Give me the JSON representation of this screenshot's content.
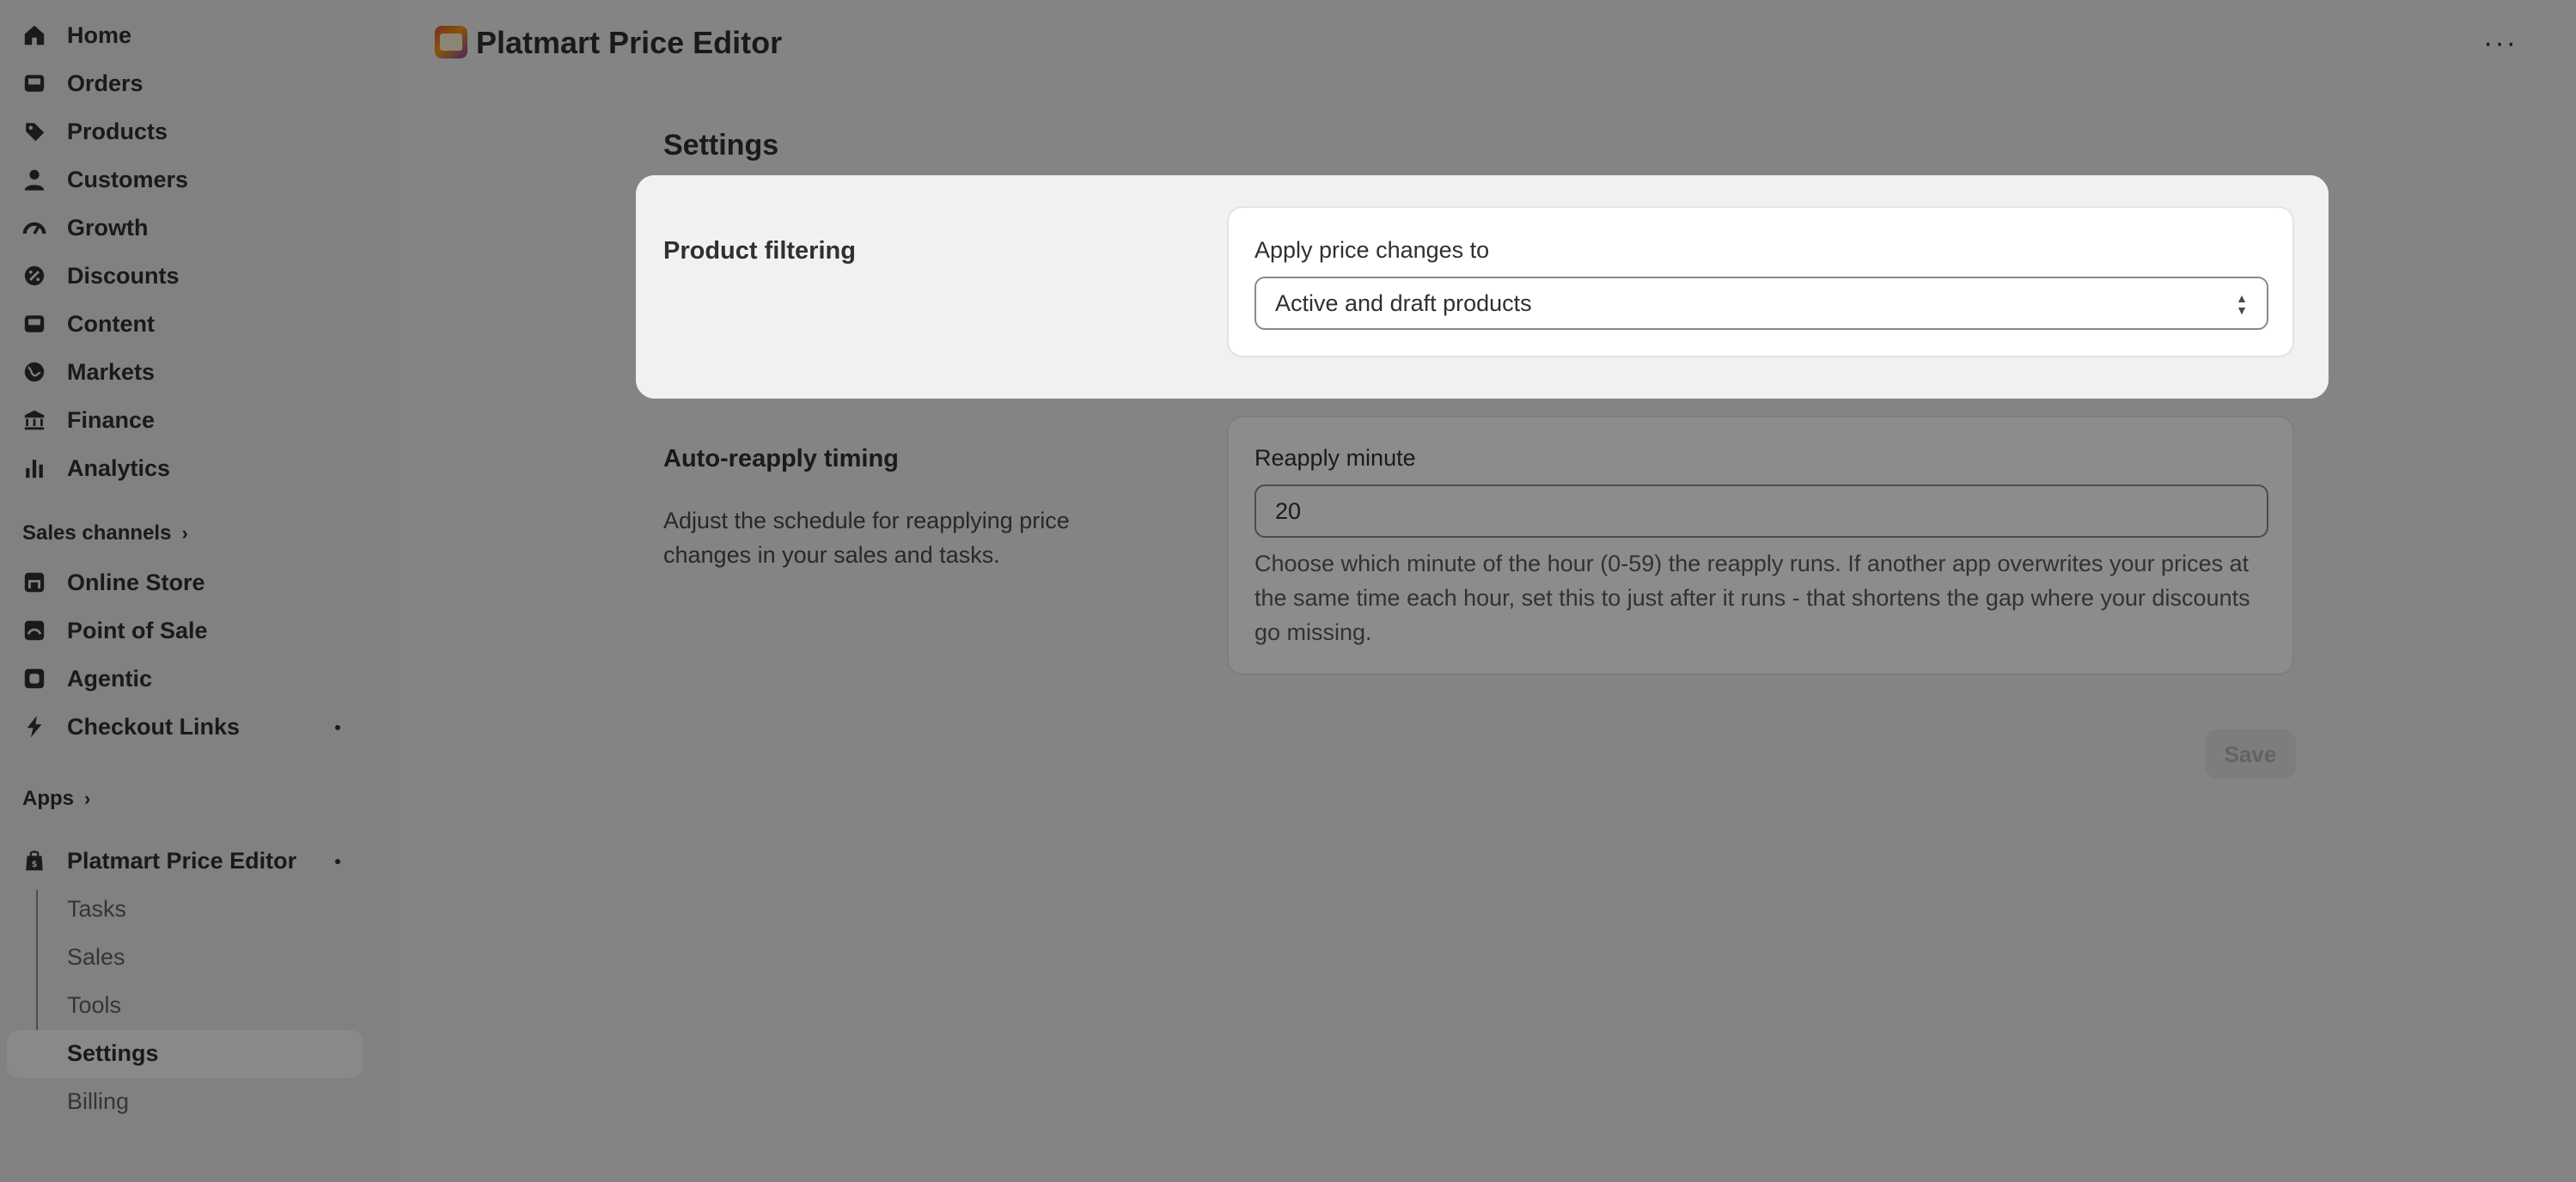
{
  "sidebar": {
    "items": [
      {
        "label": "Home",
        "icon": "home-icon"
      },
      {
        "label": "Orders",
        "icon": "inbox-icon"
      },
      {
        "label": "Products",
        "icon": "tag-icon"
      },
      {
        "label": "Customers",
        "icon": "person-icon"
      },
      {
        "label": "Growth",
        "icon": "gauge-icon"
      },
      {
        "label": "Discounts",
        "icon": "discount-icon"
      },
      {
        "label": "Content",
        "icon": "image-icon"
      },
      {
        "label": "Markets",
        "icon": "globe-icon"
      },
      {
        "label": "Finance",
        "icon": "bank-icon"
      },
      {
        "label": "Analytics",
        "icon": "bar-chart-icon"
      }
    ],
    "sales_channels_label": "Sales channels",
    "channels": [
      {
        "label": "Online Store",
        "icon": "store-icon"
      },
      {
        "label": "Point of Sale",
        "icon": "pos-icon"
      },
      {
        "label": "Agentic",
        "icon": "agentic-icon"
      },
      {
        "label": "Checkout Links",
        "icon": "lightning-icon"
      }
    ],
    "apps_label": "Apps",
    "app_name": "Platmart Price Editor",
    "app_subitems": [
      "Tasks",
      "Sales",
      "Tools",
      "Settings",
      "Billing"
    ],
    "active_subitem": "Settings"
  },
  "header": {
    "title": "Platmart Price Editor",
    "more_label": "···"
  },
  "main": {
    "page_heading": "Settings",
    "product_filtering": {
      "title": "Product filtering",
      "field_label": "Apply price changes to",
      "selected_value": "Active and draft products"
    },
    "auto_reapply": {
      "title": "Auto-reapply timing",
      "description": "Adjust the schedule for reapplying price changes in your sales and tasks.",
      "field_label": "Reapply minute",
      "value": "20",
      "help": "Choose which minute of the hour (0-59) the reapply runs. If another app overwrites your prices at the same time each hour, set this to just after it runs - that shortens the gap where your discounts go missing."
    },
    "save_label": "Save"
  }
}
